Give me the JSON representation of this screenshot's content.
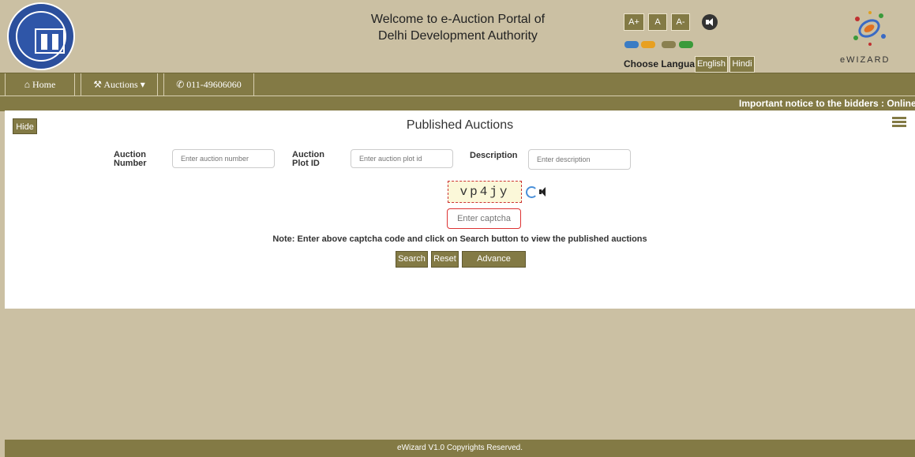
{
  "header": {
    "welcome_line1": "Welcome to e-Auction Portal of",
    "welcome_line2": "Delhi Development Authority",
    "font_buttons": [
      "A+",
      "A",
      "A-"
    ],
    "theme_colors": [
      "#3a7cc4",
      "#e8a020",
      "#8a8050",
      "#3a9a3a"
    ],
    "language_label": "Choose Language :",
    "languages": [
      "English",
      "Hindi"
    ],
    "brand": "eWIZARD"
  },
  "nav": {
    "home": "Home",
    "auctions": "Auctions",
    "phone": "011-49606060"
  },
  "ticker": {
    "text": "Important notice to the bidders : Online t"
  },
  "panel": {
    "hide_label": "Hide",
    "title": "Published Auctions",
    "fields": {
      "auction_number": {
        "label1": "Auction",
        "label2": "Number",
        "placeholder": "Enter auction number"
      },
      "plot_id": {
        "label1": "Auction",
        "label2": "Plot ID",
        "placeholder": "Enter auction plot id"
      },
      "description": {
        "label1": "Description",
        "placeholder": "Enter description"
      }
    },
    "captcha_code": "vp4jy",
    "captcha_placeholder": "Enter captcha",
    "note": "Note: Enter above captcha code and click on Search button to view the published auctions",
    "buttons": {
      "search": "Search",
      "reset": "Reset",
      "advance": "Advance Search"
    }
  },
  "footer": {
    "text": "eWizard V1.0 Copyrights Reserved."
  }
}
